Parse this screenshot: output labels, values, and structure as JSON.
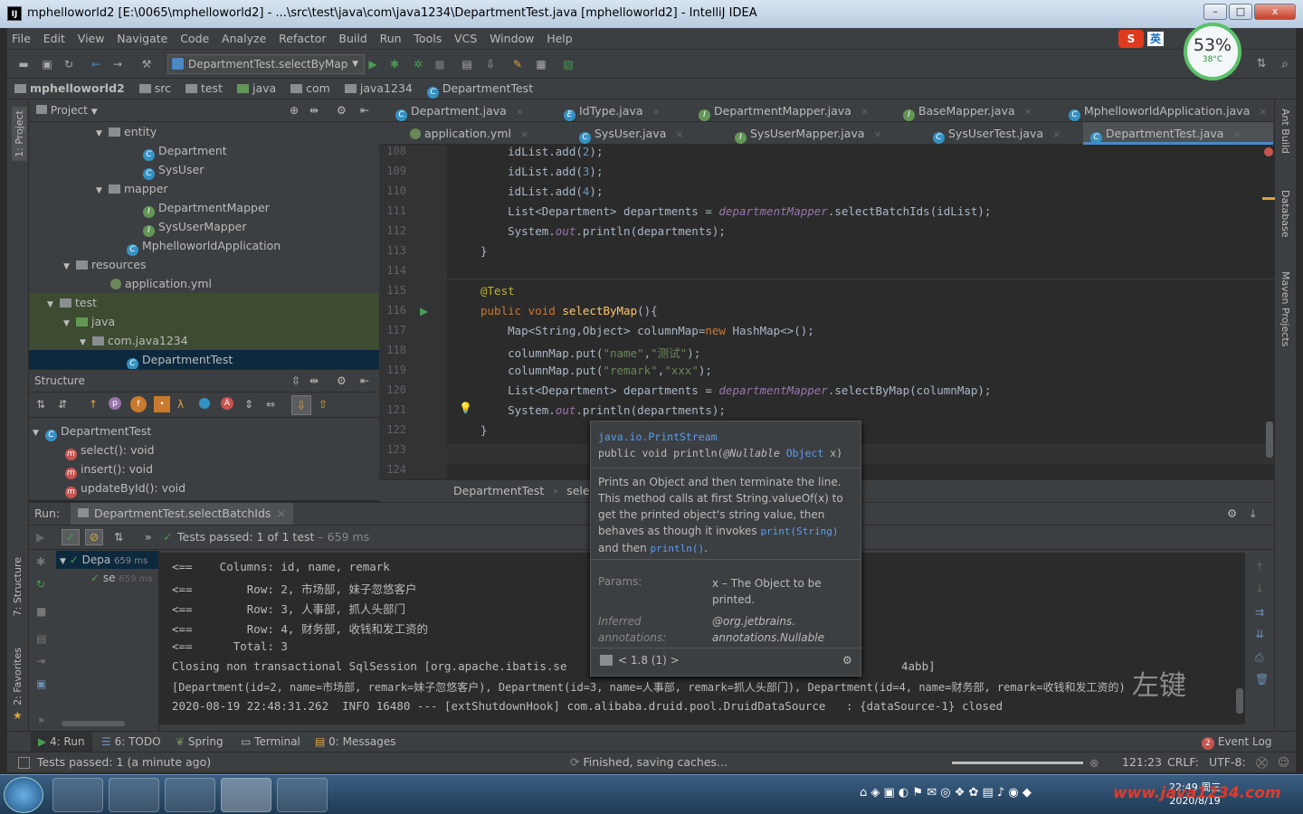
{
  "window": {
    "title": "mphelloworld2 [E:\\0065\\mphelloworld2] - ...\\src\\test\\java\\com\\java1234\\DepartmentTest.java [mphelloworld2] - IntelliJ IDEA",
    "app_icon": "IJ",
    "minimize": "–",
    "maximize": "□",
    "close": "x"
  },
  "menu": [
    "File",
    "Edit",
    "View",
    "Navigate",
    "Code",
    "Analyze",
    "Refactor",
    "Build",
    "Run",
    "Tools",
    "VCS",
    "Window",
    "Help"
  ],
  "toolbar": {
    "run_config": "DepartmentTest.selectByMap"
  },
  "ime": {
    "lang": "英",
    "cpu_percent": "53%",
    "temp": "38°C"
  },
  "breadcrumbs": [
    "mphelloworld2",
    "src",
    "test",
    "java",
    "com",
    "java1234",
    "DepartmentTest"
  ],
  "project_panel": {
    "title": "Project",
    "tree": [
      {
        "label": "entity",
        "kind": "folder",
        "depth": 5,
        "expanded": true
      },
      {
        "label": "Department",
        "kind": "class",
        "depth": 7
      },
      {
        "label": "SysUser",
        "kind": "class",
        "depth": 7
      },
      {
        "label": "mapper",
        "kind": "folder",
        "depth": 5,
        "expanded": true
      },
      {
        "label": "DepartmentMapper",
        "kind": "interface",
        "depth": 7
      },
      {
        "label": "SysUserMapper",
        "kind": "interface",
        "depth": 7
      },
      {
        "label": "MphelloworldApplication",
        "kind": "class",
        "depth": 6
      },
      {
        "label": "resources",
        "kind": "folder",
        "depth": 3,
        "expanded": true
      },
      {
        "label": "application.yml",
        "kind": "yml",
        "depth": 5
      },
      {
        "label": "test",
        "kind": "folder",
        "depth": 2,
        "expanded": true
      },
      {
        "label": "java",
        "kind": "folder",
        "depth": 3,
        "expanded": true
      },
      {
        "label": "com.java1234",
        "kind": "folder",
        "depth": 4,
        "expanded": true
      },
      {
        "label": "DepartmentTest",
        "kind": "class",
        "depth": 6,
        "selected": true
      }
    ]
  },
  "structure_panel": {
    "title": "Structure",
    "root": "DepartmentTest",
    "methods": [
      "select(): void",
      "insert(): void",
      "updateById(): void"
    ]
  },
  "editor": {
    "tabs_row1": [
      "Department.java",
      "IdType.java",
      "DepartmentMapper.java",
      "BaseMapper.java",
      "MphelloworldApplication.java"
    ],
    "tabs_row2": [
      "application.yml",
      "SysUser.java",
      "SysUserMapper.java",
      "SysUserTest.java",
      "DepartmentTest.java"
    ],
    "line_numbers": [
      "108",
      "109",
      "110",
      "111",
      "112",
      "113",
      "114",
      "115",
      "116",
      "117",
      "118",
      "119",
      "120",
      "121",
      "122",
      "123",
      "124"
    ],
    "breadcrumb": [
      "DepartmentTest",
      "select"
    ]
  },
  "popup": {
    "class": "java.io.PrintStream",
    "signature_prefix": "public void println(",
    "signature_ann": "@Nullable",
    "signature_type": "Object",
    "signature_suffix": " x)",
    "desc1": "Prints an Object and then terminate the line.",
    "desc2": "This method calls at first String.valueOf(x) to",
    "desc3": "get the printed object's string value, then",
    "desc4": "behaves as though it invokes ",
    "desc4_link": "print(String)",
    "desc5": "and then ",
    "desc5_link": "println()",
    "desc5_end": ".",
    "params_label": "Params:",
    "params_value1": "x – The Object to be",
    "params_value2": "printed.",
    "inferred_label1": "Inferred",
    "inferred_label2": "annotations:",
    "inferred_value1": "@org.jetbrains.",
    "inferred_value2": "annotations.Nullable",
    "jdk": "< 1.8 (1) >"
  },
  "run_panel": {
    "label": "Run:",
    "tab": "DepartmentTest.selectBatchIds",
    "status": "Tests passed:",
    "status_count": "1 of 1 test",
    "status_time": "– 659 ms",
    "tree_root": "Depa",
    "tree_root_time": "659 ms",
    "tree_child": "se",
    "tree_child_time": "659 ms",
    "console": [
      "<==    Columns: id, name, remark",
      "<==        Row: 2, 市场部, 妹子忽悠客户",
      "<==        Row: 3, 人事部, 抓人头部门",
      "<==        Row: 4, 财务部, 收钱和发工资的",
      "<==      Total: 3",
      "Closing non transactional SqlSession [org.apache.ibatis.se",
      "[Department(id=2, name=市场部, remark=妹子忽悠客户), Department(id=3, name=人事部, remark=抓人头部门), Department(id=4, name=财务部, remark=收钱和发工资的)",
      "2020-08-19 22:48:31.262  INFO 16480 --- [extShutdownHook] com.alibaba.druid.pool.DruidDataSource   : {dataSource-1} closed"
    ],
    "console_tail": "4abb]",
    "watermark": "左键"
  },
  "bottom_tabs": [
    "4: Run",
    "6: TODO",
    "Spring",
    "Terminal",
    "0: Messages"
  ],
  "event_log": {
    "count": "2",
    "label": "Event Log"
  },
  "status_bar": {
    "left": "Tests passed: 1 (a minute ago)",
    "middle": "Finished, saving caches...",
    "position": "121:23",
    "line_sep": "CRLF:",
    "encoding": "UTF-8:"
  },
  "side_tabs": {
    "left": [
      "1: Project",
      "7: Structure",
      "2: Favorites"
    ],
    "right": [
      "Ant Build",
      "Database",
      "Maven Projects"
    ]
  },
  "taskbar": {
    "time": "22:49 周三",
    "date": "2020/8/19",
    "site": "www.java1234.com"
  }
}
